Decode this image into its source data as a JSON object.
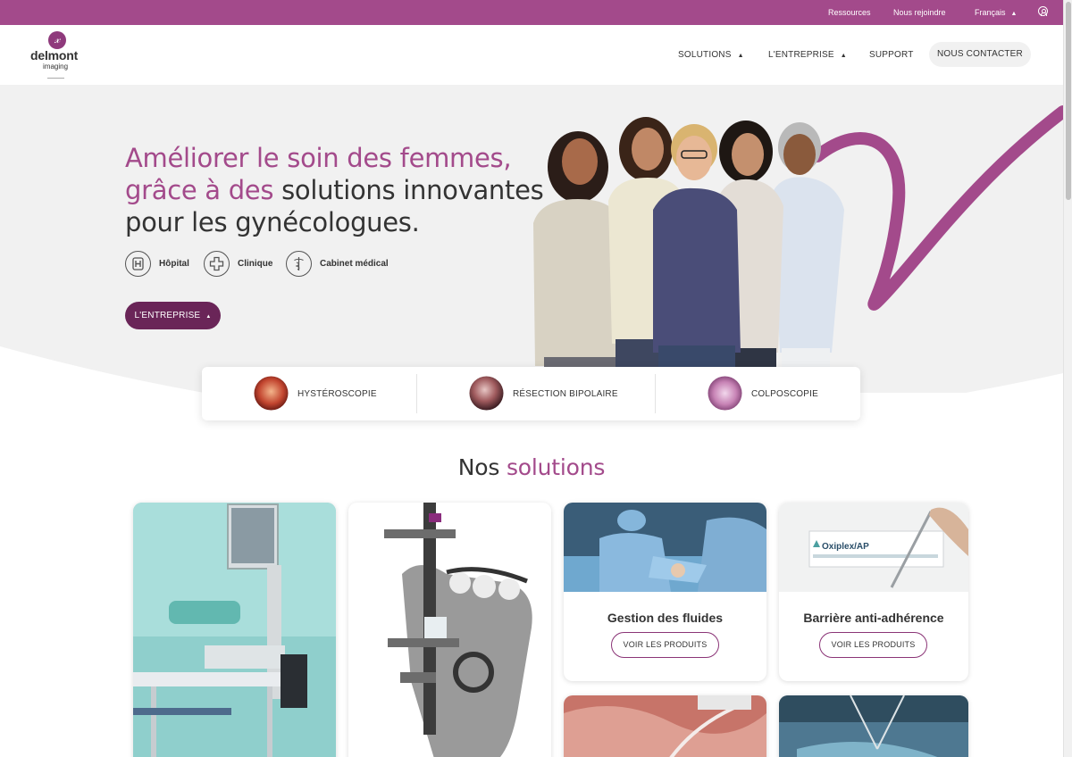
{
  "topbar": {
    "links": [
      "Ressources",
      "Nous rejoindre"
    ],
    "language": "Français"
  },
  "header": {
    "logo_name": "delmont",
    "logo_sub": "imaging",
    "nav": [
      "SOLUTIONS",
      "L'ENTREPRISE",
      "SUPPORT"
    ],
    "contact": "NOUS CONTACTER"
  },
  "hero": {
    "line1": "Améliorer le soin des femmes,",
    "line2_purple": "grâce à des",
    "line2_dark": "solutions innovantes",
    "line3": "pour les gynécologues.",
    "facilities": [
      "Hôpital",
      "Clinique",
      "Cabinet médical"
    ],
    "cta": "L'ENTREPRISE"
  },
  "categories": [
    "HYSTÉROSCOPIE",
    "RÉSECTION BIPOLAIRE",
    "COLPOSCOPIE"
  ],
  "solutions": {
    "title_dark": "Nos",
    "title_purple": "solutions",
    "cards": [
      {
        "title": "Gestion des fluides",
        "button": "VOIR LES PRODUITS"
      },
      {
        "title": "Barrière anti-adhérence",
        "button": "VOIR LES PRODUITS"
      }
    ],
    "product_label": "Oxiplex/AP"
  },
  "colors": {
    "brand": "#a34a8b",
    "brand_dark": "#6a2558",
    "hero_bg": "#f1f1f1"
  },
  "icons": [
    "user-icon",
    "hospital-icon",
    "clinic-icon",
    "medical-office-icon"
  ]
}
